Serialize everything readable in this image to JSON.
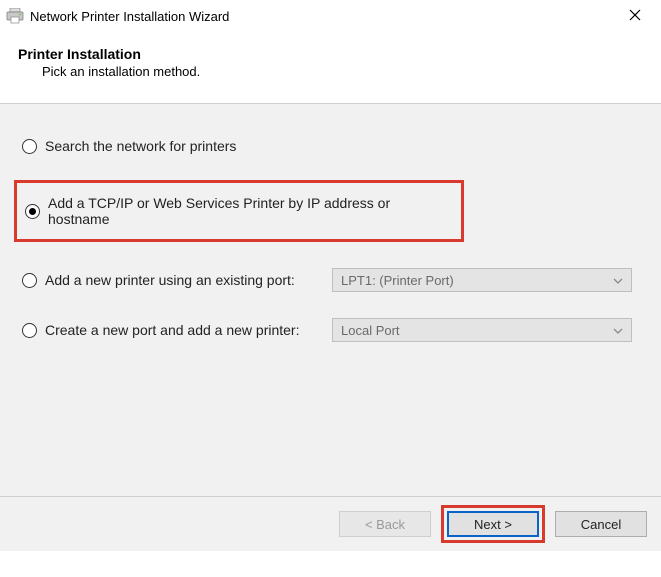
{
  "window": {
    "title": "Network Printer Installation Wizard"
  },
  "header": {
    "title": "Printer Installation",
    "subtitle": "Pick an installation method."
  },
  "options": {
    "search": "Search the network for printers",
    "tcpip": "Add a TCP/IP or Web Services Printer by IP address or hostname",
    "existing_port": "Add a new printer using an existing port:",
    "new_port": "Create a new port and add a new printer:"
  },
  "selects": {
    "existing_port_value": "LPT1: (Printer Port)",
    "new_port_value": "Local Port"
  },
  "buttons": {
    "back": "< Back",
    "next": "Next >",
    "cancel": "Cancel"
  }
}
